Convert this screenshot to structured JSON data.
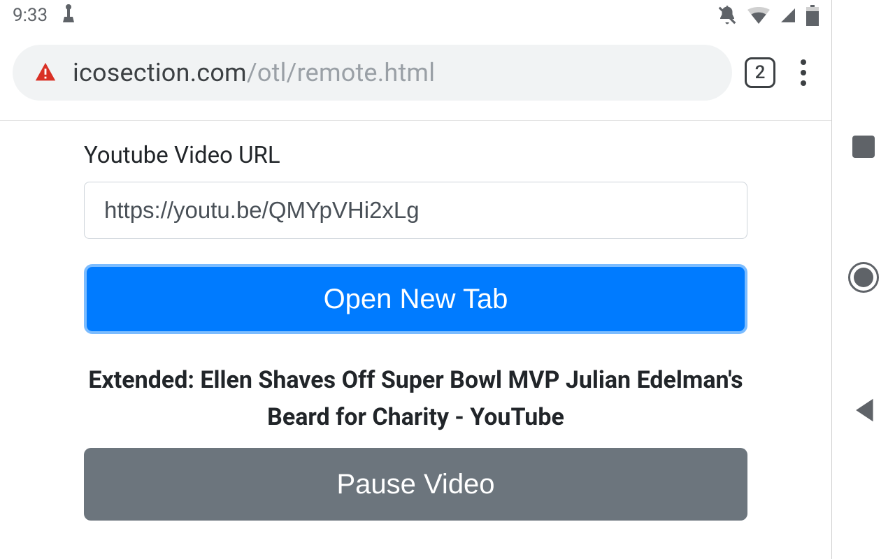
{
  "status": {
    "time": "9:33",
    "tab_count": "2"
  },
  "omnibox": {
    "url_host": "icosection.com",
    "url_path": "/otl/remote.html"
  },
  "page": {
    "label": "Youtube Video URL",
    "url_value": "https://youtu.be/QMYpVHi2xLg",
    "open_tab_label": "Open New Tab",
    "video_title": "Extended: Ellen Shaves Off Super Bowl MVP Julian Edelman's Beard for Charity - YouTube",
    "pause_label": "Pause Video"
  },
  "colors": {
    "primary": "#007bff",
    "secondary": "#6c757d",
    "warn": "#d93025"
  }
}
